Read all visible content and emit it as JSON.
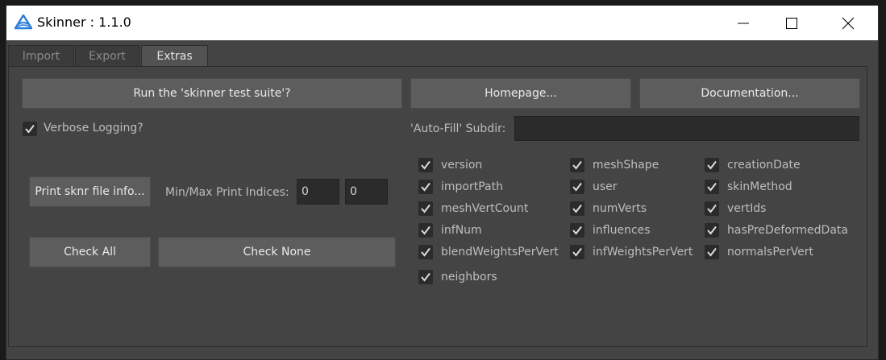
{
  "window": {
    "title": "Skinner : 1.1.0"
  },
  "tabs": [
    {
      "label": "Import",
      "active": false
    },
    {
      "label": "Export",
      "active": false
    },
    {
      "label": "Extras",
      "active": true
    }
  ],
  "extras": {
    "run_tests_label": "Run the 'skinner test suite'?",
    "homepage_label": "Homepage...",
    "documentation_label": "Documentation...",
    "verbose_label": "Verbose Logging?",
    "verbose_checked": true,
    "autofill_label": "'Auto-Fill' Subdir:",
    "autofill_value": "",
    "print_label": "Print sknr file info...",
    "minmax_label": "Min/Max Print Indices:",
    "min_value": "0",
    "max_value": "0",
    "check_all_label": "Check All",
    "check_none_label": "Check None",
    "options": [
      {
        "label": "version",
        "checked": true
      },
      {
        "label": "meshShape",
        "checked": true
      },
      {
        "label": "creationDate",
        "checked": true
      },
      {
        "label": "importPath",
        "checked": true
      },
      {
        "label": "user",
        "checked": true
      },
      {
        "label": "skinMethod",
        "checked": true
      },
      {
        "label": "meshVertCount",
        "checked": true
      },
      {
        "label": "numVerts",
        "checked": true
      },
      {
        "label": "vertIds",
        "checked": true
      },
      {
        "label": "infNum",
        "checked": true
      },
      {
        "label": "influences",
        "checked": true
      },
      {
        "label": "hasPreDeformedData",
        "checked": true
      },
      {
        "label": "blendWeightsPerVert",
        "checked": true
      },
      {
        "label": "infWeightsPerVert",
        "checked": true
      },
      {
        "label": "normalsPerVert",
        "checked": true
      },
      {
        "label": "neighbors",
        "checked": true
      }
    ]
  }
}
